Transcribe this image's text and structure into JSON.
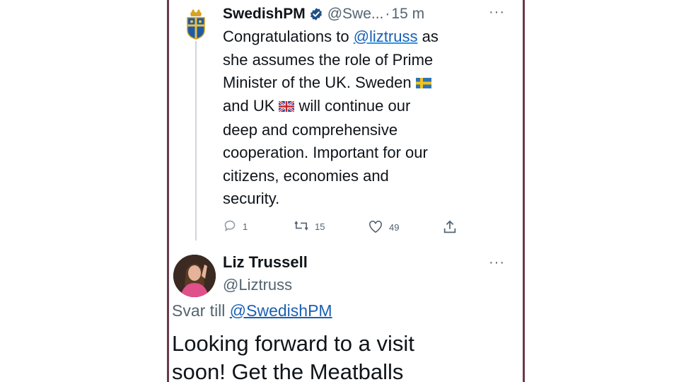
{
  "tweet1": {
    "display_name": "SwedishPM",
    "handle": "@Swe...",
    "separator": "·",
    "time": "15 m",
    "more": "···",
    "text_pre": "Congratulations to",
    "mention": "@liztruss",
    "text_lines": [
      "as",
      "she assumes the role of Prime",
      "Minister of the UK. Sweden",
      "and UK",
      "will continue our",
      "deep and comprehensive",
      "cooperation. Important for our",
      "citizens, economies and",
      "security."
    ],
    "actions": {
      "reply_count": "1",
      "retweet_count": "15",
      "like_count": "49"
    },
    "icons": [
      "verified-badge-icon",
      "sweden-flag-icon",
      "uk-flag-icon",
      "reply-icon",
      "retweet-icon",
      "like-icon",
      "share-icon",
      "more-icon"
    ]
  },
  "tweet2": {
    "display_name": "Liz Trussell",
    "handle": "@Liztruss",
    "more": "···",
    "reply_prefix": "Svar till",
    "reply_mention": "@SwedishPM",
    "text_lines": [
      "Looking forward to a visit",
      "soon! Get the Meatballs"
    ]
  },
  "colors": {
    "accent": "#1d9bf0",
    "mention_link": "#1a5fb4",
    "frame_border": "#6b3a4a",
    "muted_text": "#536471"
  }
}
